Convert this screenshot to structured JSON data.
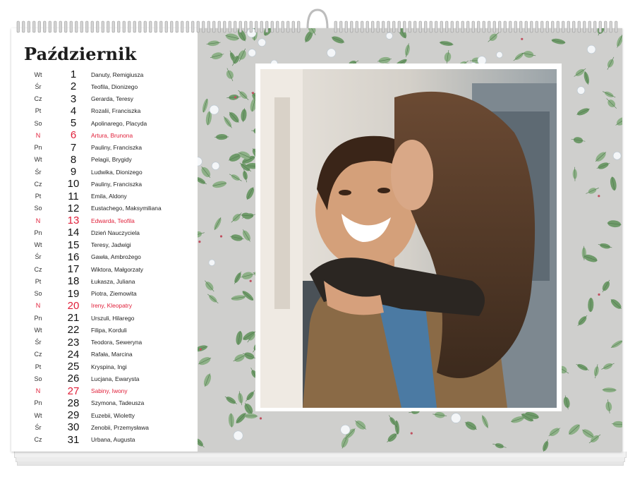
{
  "calendar": {
    "month": "Październik",
    "days": [
      {
        "wd": "Wt",
        "d": "1",
        "names": "Danuty, Remigiusza",
        "sun": false
      },
      {
        "wd": "Śr",
        "d": "2",
        "names": "Teofila, Dionizego",
        "sun": false
      },
      {
        "wd": "Cz",
        "d": "3",
        "names": "Gerarda, Teresy",
        "sun": false
      },
      {
        "wd": "Pt",
        "d": "4",
        "names": "Rozalii, Franciszka",
        "sun": false
      },
      {
        "wd": "So",
        "d": "5",
        "names": "Apolinarego, Placyda",
        "sun": false
      },
      {
        "wd": "N",
        "d": "6",
        "names": "Artura, Brunona",
        "sun": true
      },
      {
        "wd": "Pn",
        "d": "7",
        "names": "Pauliny, Franciszka",
        "sun": false
      },
      {
        "wd": "Wt",
        "d": "8",
        "names": "Pelagii, Brygidy",
        "sun": false
      },
      {
        "wd": "Śr",
        "d": "9",
        "names": "Ludwika, Dionizego",
        "sun": false
      },
      {
        "wd": "Cz",
        "d": "10",
        "names": "Pauliny, Franciszka",
        "sun": false
      },
      {
        "wd": "Pt",
        "d": "11",
        "names": "Emila, Aldony",
        "sun": false
      },
      {
        "wd": "So",
        "d": "12",
        "names": "Eustachego, Maksymiliana",
        "sun": false
      },
      {
        "wd": "N",
        "d": "13",
        "names": "Edwarda, Teofila",
        "sun": true
      },
      {
        "wd": "Pn",
        "d": "14",
        "names": "Dzień Nauczyciela",
        "sun": false
      },
      {
        "wd": "Wt",
        "d": "15",
        "names": "Teresy, Jadwigi",
        "sun": false
      },
      {
        "wd": "Śr",
        "d": "16",
        "names": "Gawła, Ambrożego",
        "sun": false
      },
      {
        "wd": "Cz",
        "d": "17",
        "names": "Wiktora, Małgorzaty",
        "sun": false
      },
      {
        "wd": "Pt",
        "d": "18",
        "names": "Łukasza, Juliana",
        "sun": false
      },
      {
        "wd": "So",
        "d": "19",
        "names": "Piotra, Ziemowita",
        "sun": false
      },
      {
        "wd": "N",
        "d": "20",
        "names": "Ireny, Kleopatry",
        "sun": true
      },
      {
        "wd": "Pn",
        "d": "21",
        "names": "Urszuli, Hilarego",
        "sun": false
      },
      {
        "wd": "Wt",
        "d": "22",
        "names": "Filipa, Korduli",
        "sun": false
      },
      {
        "wd": "Śr",
        "d": "23",
        "names": "Teodora, Seweryna",
        "sun": false
      },
      {
        "wd": "Cz",
        "d": "24",
        "names": "Rafała, Marcina",
        "sun": false
      },
      {
        "wd": "Pt",
        "d": "25",
        "names": "Kryspina, Ingi",
        "sun": false
      },
      {
        "wd": "So",
        "d": "26",
        "names": "Lucjana, Ewarysta",
        "sun": false
      },
      {
        "wd": "N",
        "d": "27",
        "names": "Sabiny, Iwony",
        "sun": true
      },
      {
        "wd": "Pn",
        "d": "28",
        "names": "Szymona, Tadeusza",
        "sun": false
      },
      {
        "wd": "Wt",
        "d": "29",
        "names": "Euzebii, Wioletty",
        "sun": false
      },
      {
        "wd": "Śr",
        "d": "30",
        "names": "Zenobii, Przemysława",
        "sun": false
      },
      {
        "wd": "Cz",
        "d": "31",
        "names": "Urbana, Augusta",
        "sun": false
      }
    ]
  },
  "colors": {
    "holiday": "#e0203a",
    "text": "#222222",
    "pattern_bg": "#cfcfcd",
    "leaf": "#6f9a6a"
  },
  "photo": {
    "subject": "couple-photo"
  }
}
